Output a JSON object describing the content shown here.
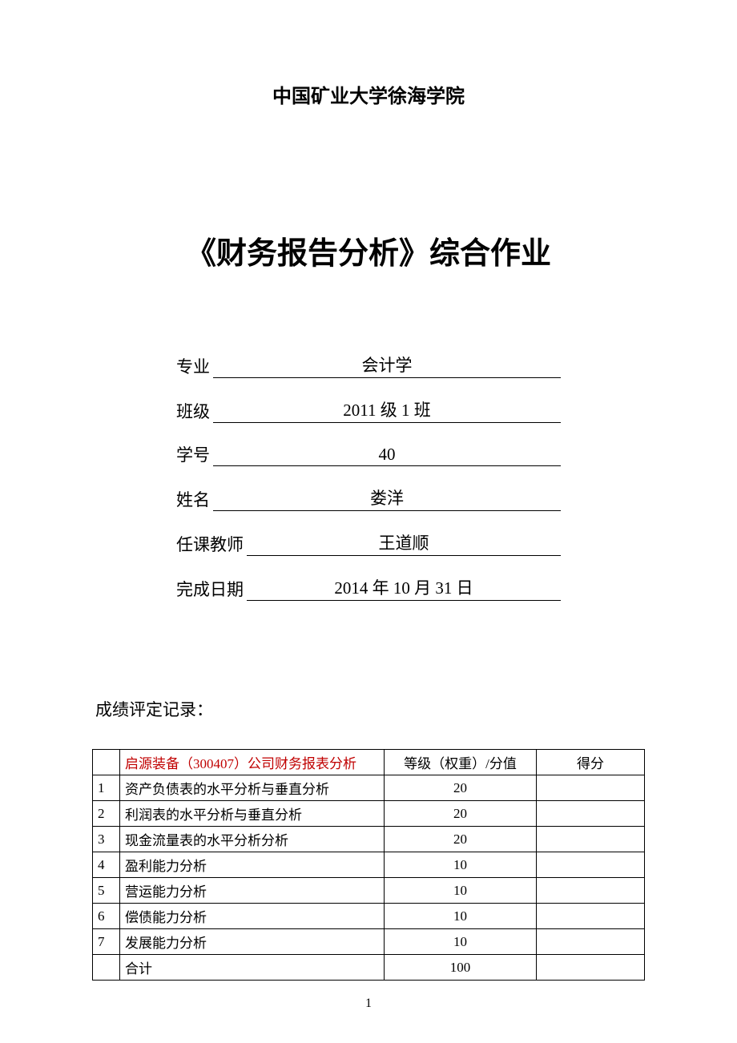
{
  "university": "中国矿业大学徐海学院",
  "title": "《财务报告分析》综合作业",
  "info": {
    "major_label": "专业",
    "major_value": "会计学",
    "class_label": "班级",
    "class_value": "2011 级 1 班",
    "studentno_label": "学号",
    "studentno_value": "40",
    "name_label": "姓名",
    "name_value": "娄洋",
    "teacher_label": "任课教师",
    "teacher_value": "王道顺",
    "date_label": "完成日期",
    "date_value": "2014 年 10 月 31 日"
  },
  "grading": {
    "heading": "成绩评定记录：",
    "header_topic": "启源装备（300407）公司财务报表分析",
    "header_weight": "等级（权重）/分值",
    "header_score": "得分",
    "rows": [
      {
        "idx": "1",
        "item": "资产负债表的水平分析与垂直分析",
        "weight": "20",
        "score": ""
      },
      {
        "idx": "2",
        "item": "利润表的水平分析与垂直分析",
        "weight": "20",
        "score": ""
      },
      {
        "idx": "3",
        "item": "现金流量表的水平分析分析",
        "weight": "20",
        "score": ""
      },
      {
        "idx": "4",
        "item": "盈利能力分析",
        "weight": "10",
        "score": ""
      },
      {
        "idx": "5",
        "item": "营运能力分析",
        "weight": "10",
        "score": ""
      },
      {
        "idx": "6",
        "item": "偿债能力分析",
        "weight": "10",
        "score": ""
      },
      {
        "idx": "7",
        "item": "发展能力分析",
        "weight": "10",
        "score": ""
      }
    ],
    "total_label": "合计",
    "total_weight": "100",
    "total_score": ""
  },
  "page_number": "1"
}
